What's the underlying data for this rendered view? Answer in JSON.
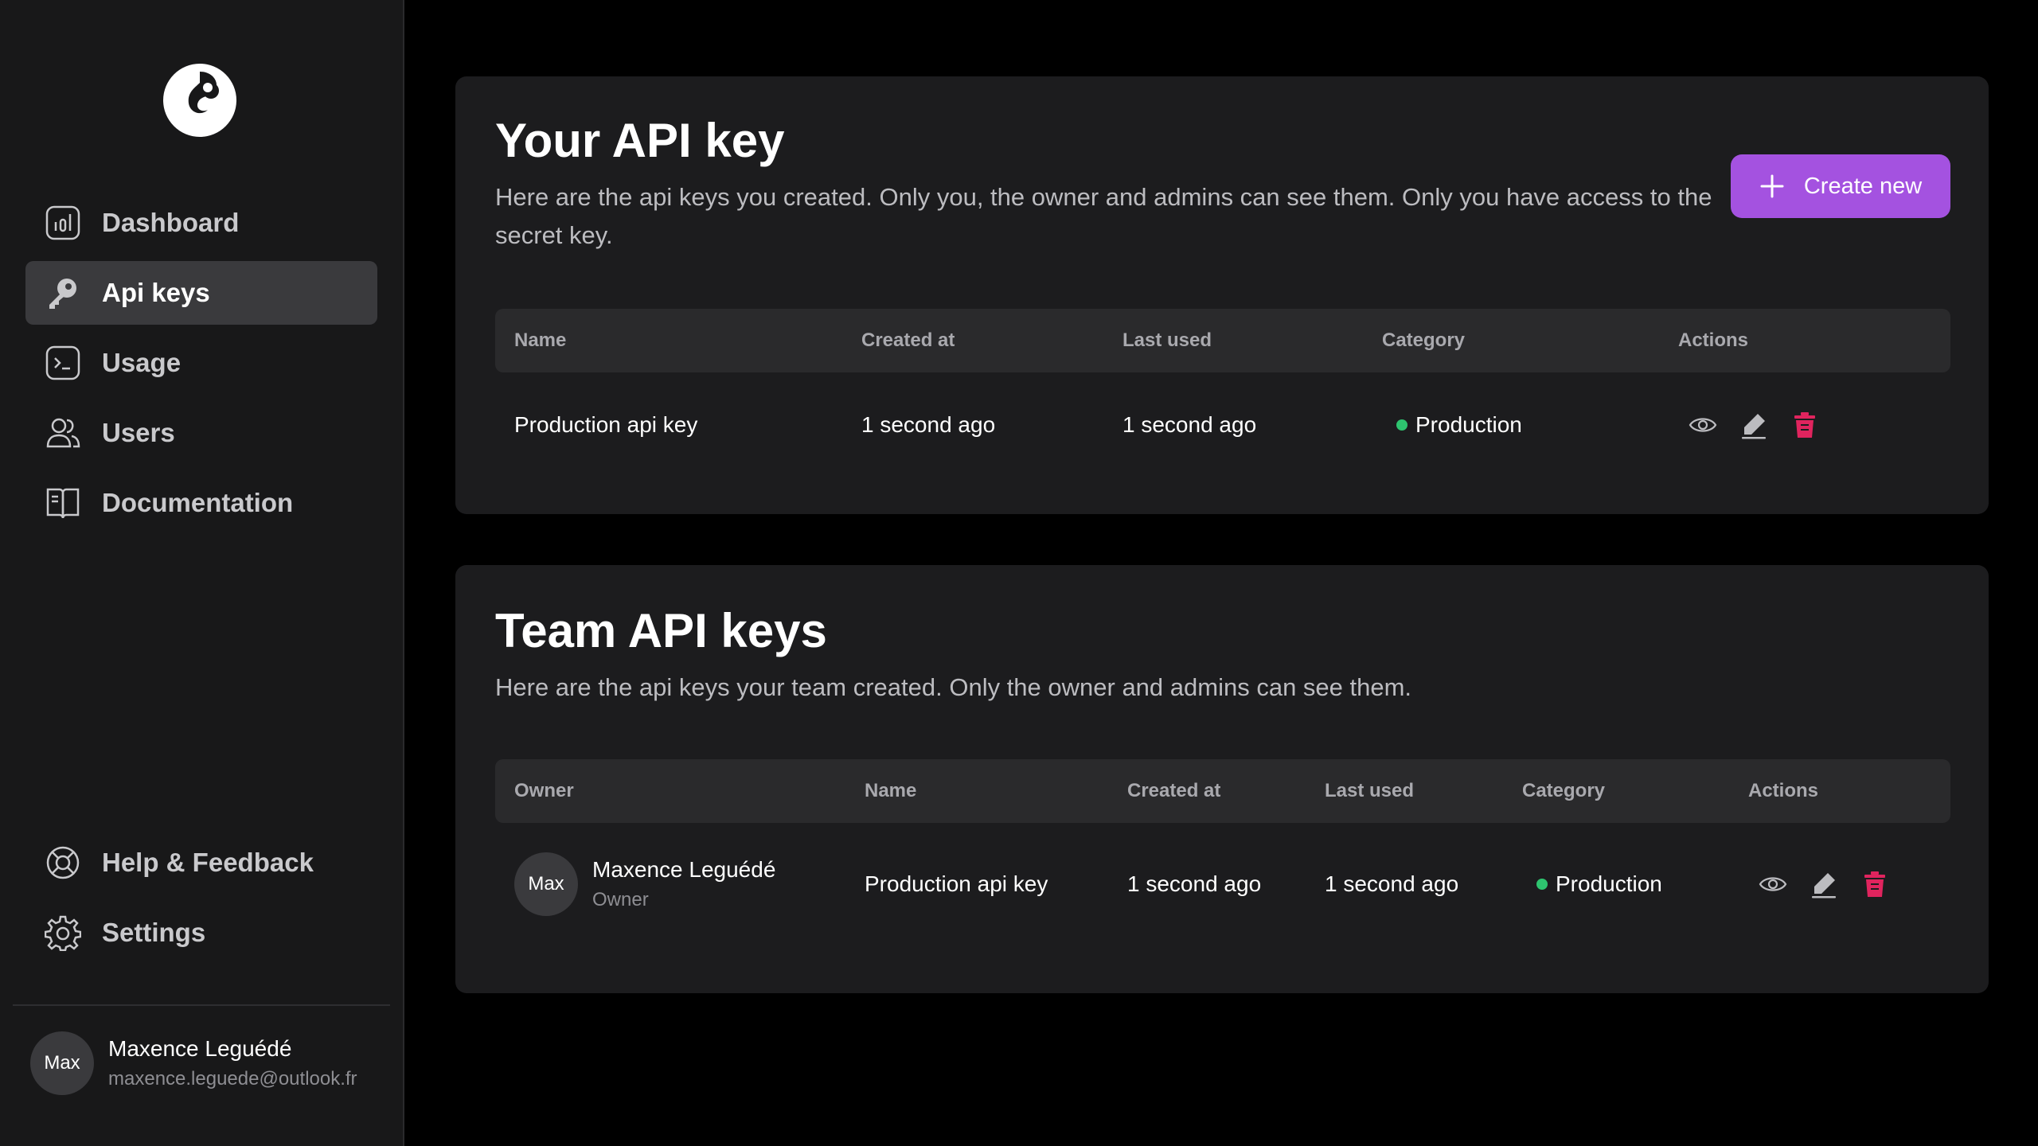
{
  "sidebar": {
    "items": [
      {
        "label": "Dashboard",
        "icon": "chart-bar-icon"
      },
      {
        "label": "Api keys",
        "icon": "key-icon",
        "active": true
      },
      {
        "label": "Usage",
        "icon": "terminal-icon"
      },
      {
        "label": "Users",
        "icon": "users-icon"
      },
      {
        "label": "Documentation",
        "icon": "book-icon"
      }
    ],
    "bottom_items": [
      {
        "label": "Help & Feedback",
        "icon": "lifebuoy-icon"
      },
      {
        "label": "Settings",
        "icon": "gear-icon"
      }
    ],
    "user": {
      "avatar": "Max",
      "name": "Maxence Leguédé",
      "email": "maxence.leguede@outlook.fr"
    }
  },
  "your_keys": {
    "title": "Your API key",
    "description": "Here are the api keys you created. Only you, the owner and admins can see them. Only you have access to the secret key.",
    "create_label": "Create new",
    "columns": [
      "Name",
      "Created at",
      "Last used",
      "Category",
      "Actions"
    ],
    "rows": [
      {
        "name": "Production api key",
        "created_at": "1 second ago",
        "last_used": "1 second ago",
        "category": "Production"
      }
    ]
  },
  "team_keys": {
    "title": "Team API keys",
    "description": "Here are the api keys your team created. Only the owner and admins can see them.",
    "columns": [
      "Owner",
      "Name",
      "Created at",
      "Last used",
      "Category",
      "Actions"
    ],
    "rows": [
      {
        "owner_avatar": "Max",
        "owner_name": "Maxence Leguédé",
        "owner_role": "Owner",
        "name": "Production api key",
        "created_at": "1 second ago",
        "last_used": "1 second ago",
        "category": "Production"
      }
    ]
  },
  "colors": {
    "accent": "#a452e0",
    "production_dot": "#2ec46f",
    "delete": "#e0245e"
  }
}
